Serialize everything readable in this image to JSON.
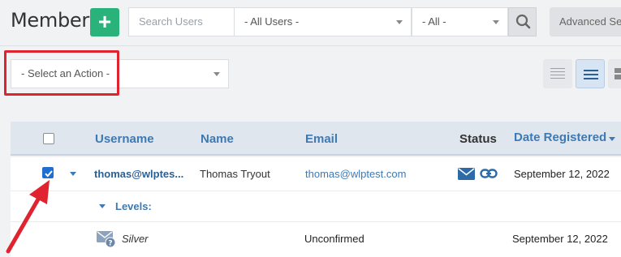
{
  "header": {
    "title": "Members",
    "add_label": "+",
    "search_placeholder": "Search Users",
    "users_filter": "- All Users -",
    "status_filter": "- All -",
    "advanced_search_label": "Advanced Search"
  },
  "actions": {
    "select_label": "- Select an Action -"
  },
  "table": {
    "columns": [
      "Username",
      "Name",
      "Email",
      "Status",
      "Date Registered"
    ],
    "rows": [
      {
        "username": "thomas@wlptes...",
        "name": "Thomas Tryout",
        "email": "thomas@wlptest.com",
        "date_registered": "September 12, 2022",
        "checked": true
      }
    ],
    "levels_label": "Levels:",
    "level": {
      "name": "Silver",
      "status": "Unconfirmed",
      "date": "September 12, 2022"
    }
  },
  "colors": {
    "accent": "#3d7ab5",
    "add_button": "#2ab27b",
    "highlight": "#e0242f"
  }
}
